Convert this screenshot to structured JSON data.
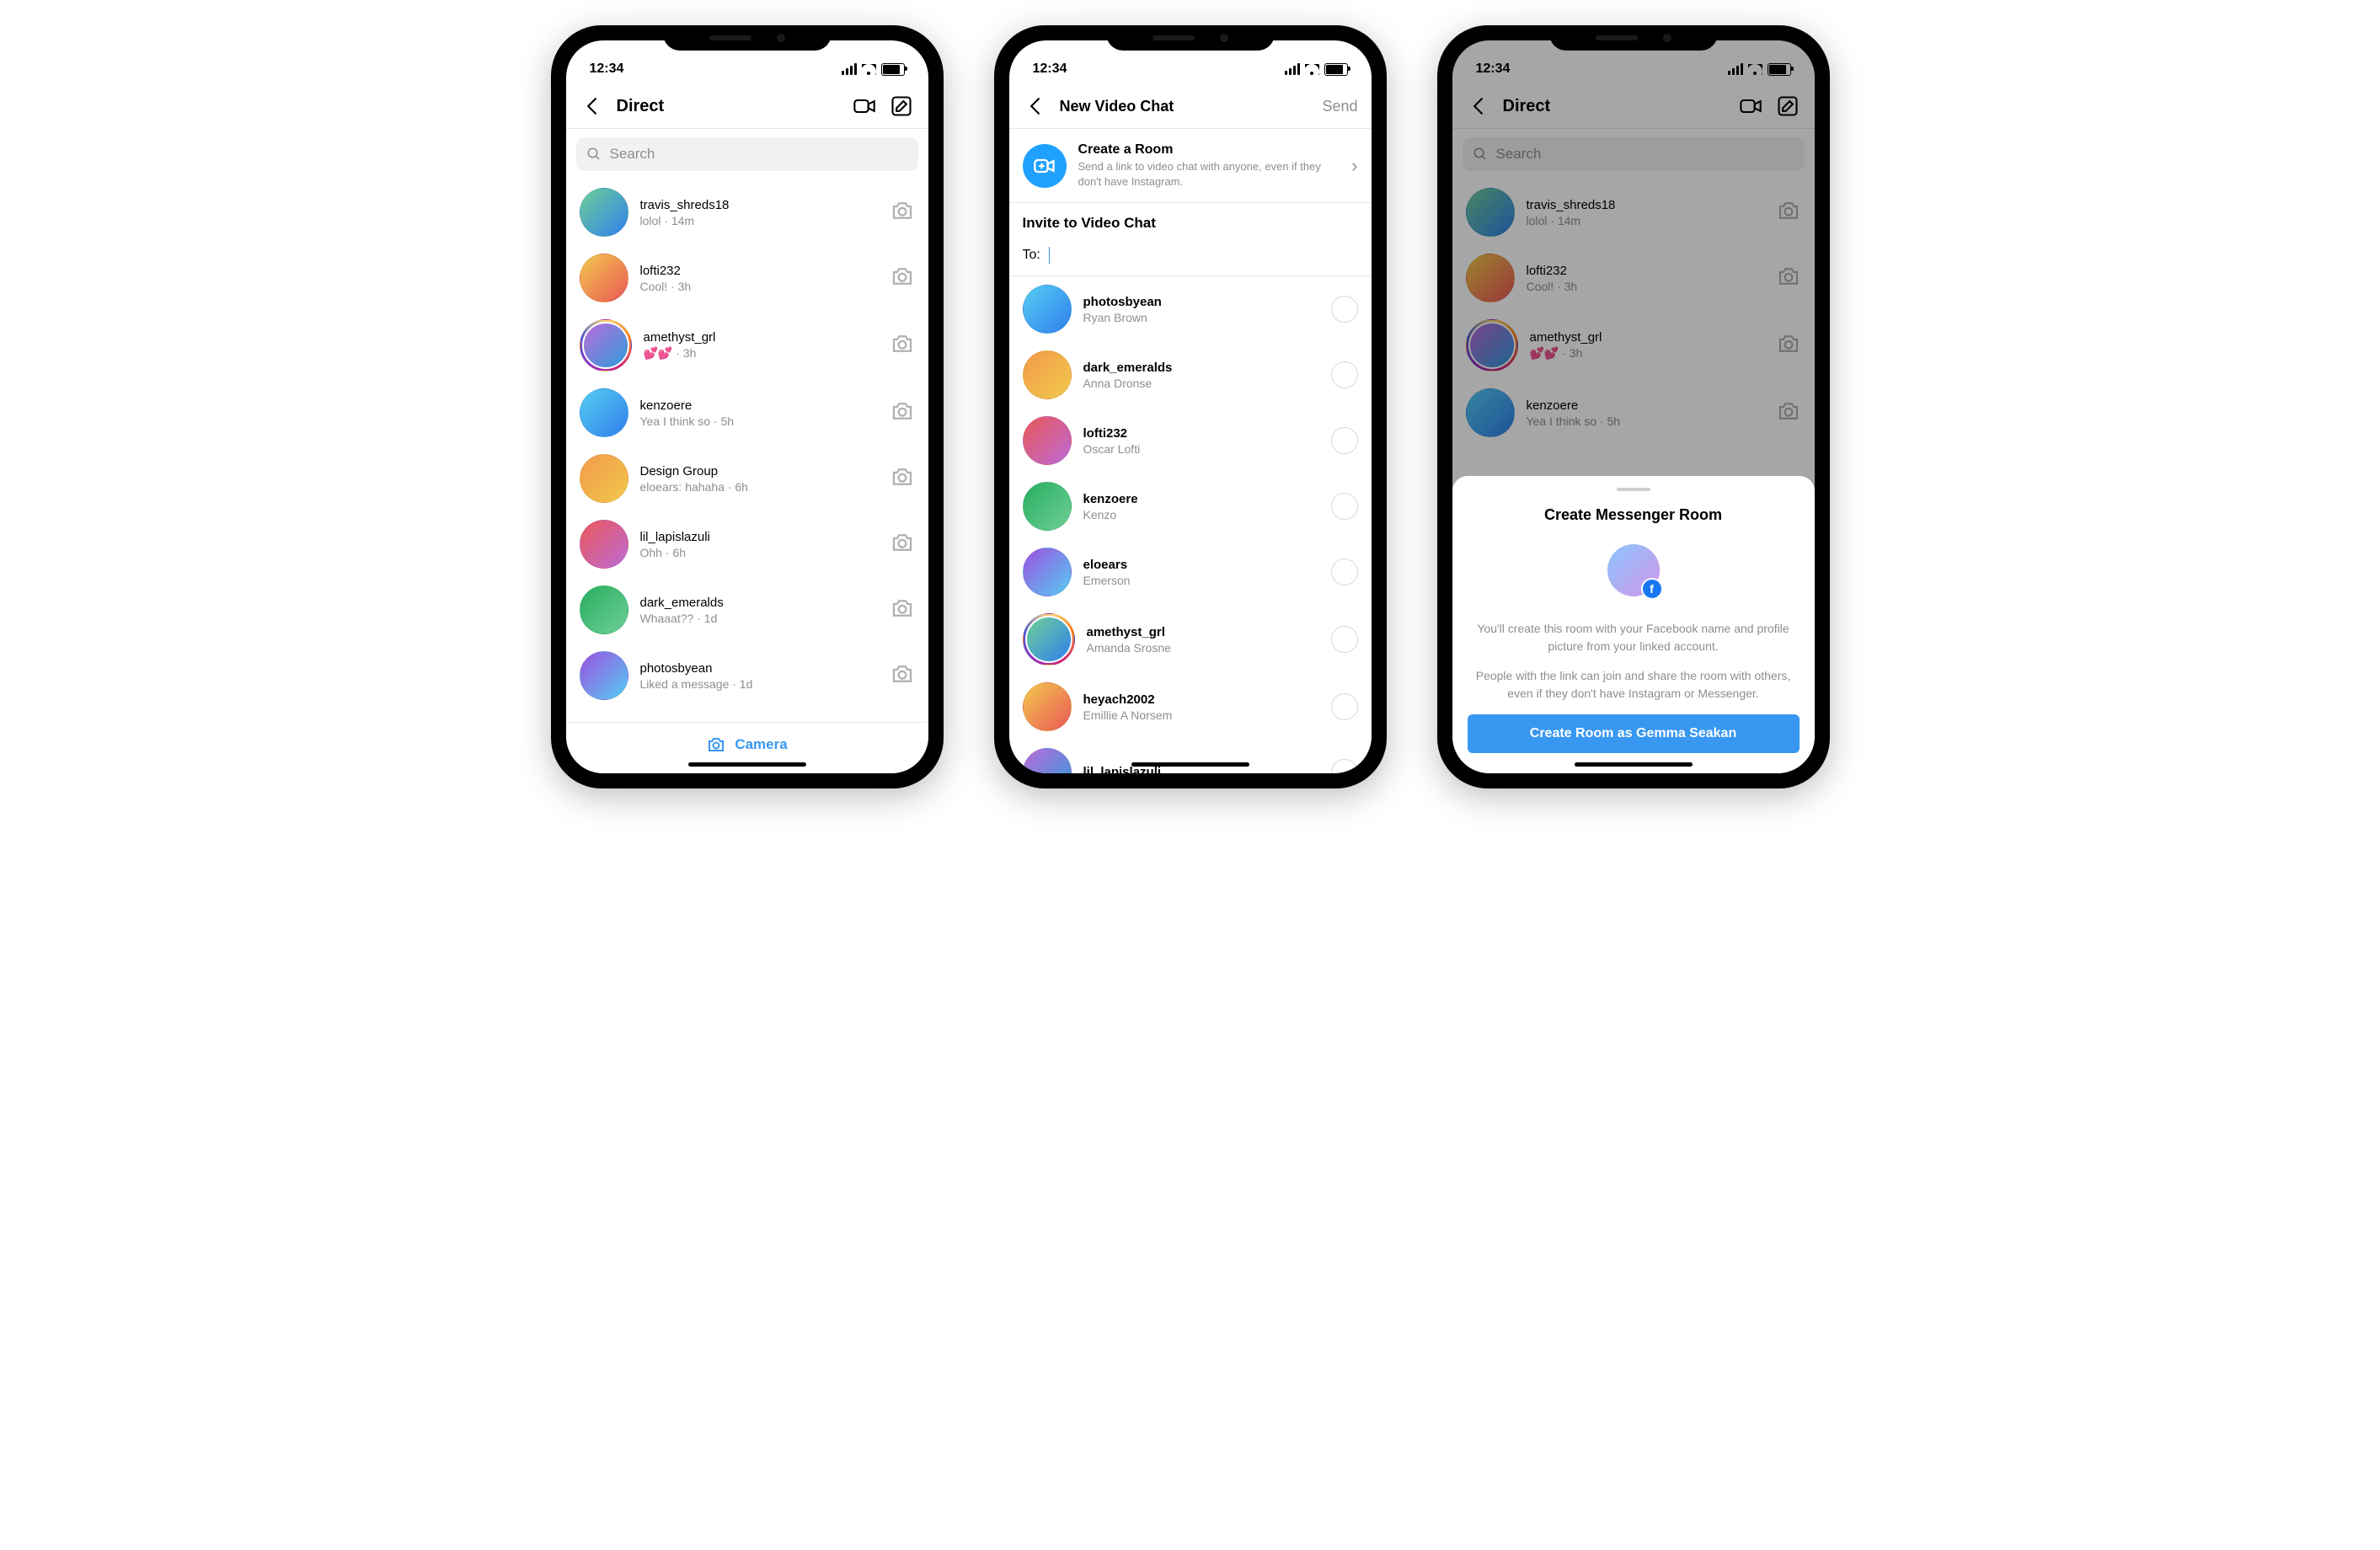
{
  "statusbar": {
    "time": "12:34"
  },
  "screen1": {
    "title": "Direct",
    "search_placeholder": "Search",
    "footer_label": "Camera",
    "chats": [
      {
        "username": "travis_shreds18",
        "preview": "lolol · 14m",
        "ring": false
      },
      {
        "username": "lofti232",
        "preview": "Cool! · 3h",
        "ring": false
      },
      {
        "username": "amethyst_grl",
        "preview": "💕💕 · 3h",
        "ring": true
      },
      {
        "username": "kenzoere",
        "preview": "Yea I think so · 5h",
        "ring": false
      },
      {
        "username": "Design Group",
        "preview": "eloears: hahaha · 6h",
        "ring": false
      },
      {
        "username": "lil_lapislazuli",
        "preview": "Ohh · 6h",
        "ring": false
      },
      {
        "username": "dark_emeralds",
        "preview": "Whaaat?? · 1d",
        "ring": false
      },
      {
        "username": "photosbyean",
        "preview": "Liked a message · 1d",
        "ring": false
      }
    ]
  },
  "screen2": {
    "title": "New Video Chat",
    "send_label": "Send",
    "banner": {
      "title": "Create a Room",
      "desc": "Send a link to video chat with anyone, even if they don't have Instagram."
    },
    "section": "Invite to Video Chat",
    "to_label": "To:",
    "contacts": [
      {
        "username": "photosbyean",
        "name": "Ryan Brown",
        "ring": false
      },
      {
        "username": "dark_emeralds",
        "name": "Anna Dronse",
        "ring": false
      },
      {
        "username": "lofti232",
        "name": "Oscar Lofti",
        "ring": false
      },
      {
        "username": "kenzoere",
        "name": "Kenzo",
        "ring": false
      },
      {
        "username": "eloears",
        "name": "Emerson",
        "ring": false
      },
      {
        "username": "amethyst_grl",
        "name": "Amanda Srosne",
        "ring": true
      },
      {
        "username": "heyach2002",
        "name": "Emillie A Norsem",
        "ring": false
      },
      {
        "username": "lil_lapislazuli",
        "name": "",
        "ring": false
      }
    ]
  },
  "screen3": {
    "sheet_title": "Create Messenger Room",
    "para1": "You'll create this room with your Facebook name and profile picture from your linked account.",
    "para2": "People with the link can join and share the room with others, even if they don't have Instagram or Messenger.",
    "button": "Create Room as Gemma Seakan"
  }
}
